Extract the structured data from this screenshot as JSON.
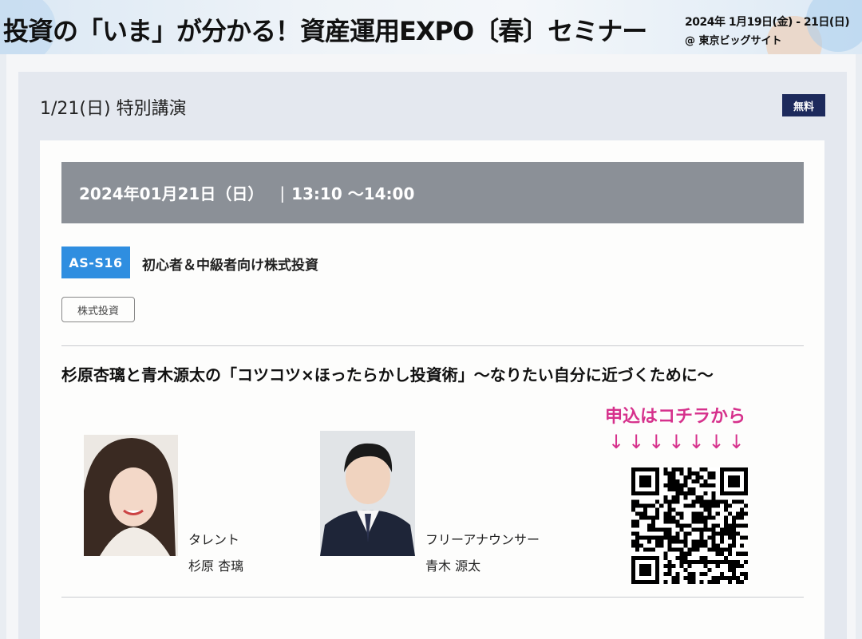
{
  "banner": {
    "title": "投資の「いま」が分かる！資産運用EXPO〔春〕セミナー",
    "date": "2024年 1月19日(金) - 21日(日)",
    "venue": "@ 東京ビッグサイト"
  },
  "section": {
    "title": "1/21(日) 特別講演",
    "badge": "無料"
  },
  "session": {
    "date": "2024年01月21日（日）",
    "separator": "|",
    "time": "13:10 〜14:00",
    "code": "AS-S16",
    "title": "初心者＆中級者向け株式投資",
    "tag": "株式投資",
    "lecture_title": "杉原杏璃と青木源太の「コツコツ×ほったらかし投資術」〜なりたい自分に近づくために〜"
  },
  "speakers": [
    {
      "role": "タレント",
      "name": "杉原 杏璃"
    },
    {
      "role": "フリーアナウンサー",
      "name": "青木 源太"
    }
  ],
  "apply": {
    "text": "申込はコチラから",
    "arrows": "↓↓↓↓↓↓↓"
  },
  "colors": {
    "badge_navy": "#1d2a5c",
    "code_blue": "#2f8ee0",
    "date_bar_gray": "#8b9097",
    "apply_pink": "#d6318c"
  }
}
